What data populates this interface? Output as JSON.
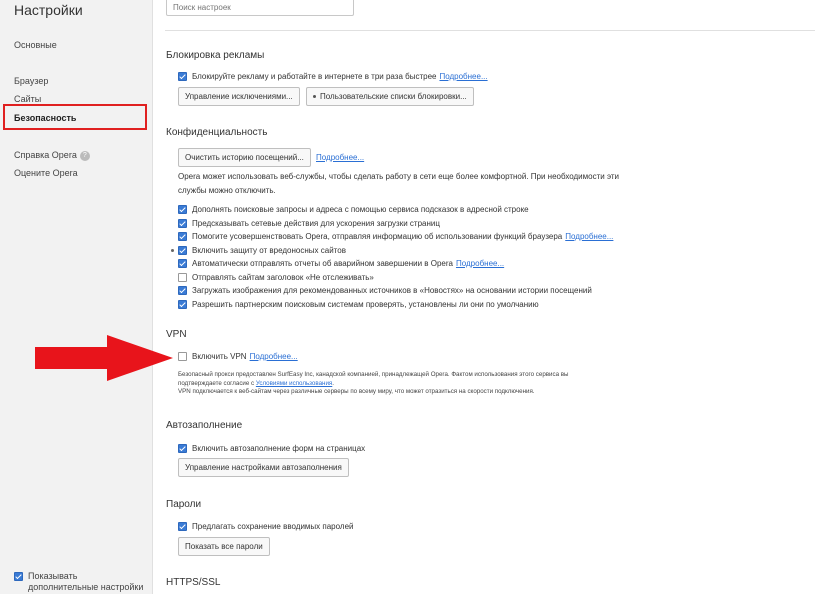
{
  "sidebar": {
    "title": "Настройки",
    "items": [
      {
        "label": "Основные"
      },
      {
        "label": "Браузер"
      },
      {
        "label": "Сайты"
      },
      {
        "label": "Безопасность"
      },
      {
        "label": "Справка Opera"
      },
      {
        "label": "Оцените Opera"
      }
    ],
    "footer_checkbox_label": "Показывать дополнительные настройки"
  },
  "search": {
    "placeholder": "Поиск настроек"
  },
  "ads": {
    "title": "Блокировка рекламы",
    "checkbox_label": "Блокируйте рекламу и работайте в интернете в три раза быстрее",
    "more": "Подробнее...",
    "exceptions_button": "Управление исключениями...",
    "lists_button": "Пользовательские списки блокировки..."
  },
  "privacy": {
    "title": "Конфиденциальность",
    "clear_button": "Очистить историю посещений...",
    "more": "Подробнее...",
    "desc_line1": "Opera может использовать веб-службы, чтобы сделать работу в сети еще более комфортной. При необходимости эти",
    "desc_line2": "службы можно отключить.",
    "options": [
      {
        "label": "Дополнять поисковые запросы и адреса с помощью сервиса подсказок в адресной строке",
        "checked": true
      },
      {
        "label": "Предсказывать сетевые действия для ускорения загрузки страниц",
        "checked": true
      },
      {
        "label": "Помогите усовершенствовать Opera, отправляя информацию об использовании функций браузера",
        "checked": true,
        "link": "Подробнее..."
      },
      {
        "label": "Включить защиту от вредоносных сайтов",
        "checked": true
      },
      {
        "label": "Автоматически отправлять отчеты об аварийном завершении в Opera",
        "checked": true,
        "link": "Подробнее..."
      },
      {
        "label": "Отправлять сайтам заголовок «Не отслеживать»",
        "checked": false
      },
      {
        "label": "Загружать изображения для рекомендованных источников в «Новостях» на основании истории посещений",
        "checked": true
      },
      {
        "label": "Разрешить партнерским поисковым системам проверять, установлены ли они по умолчанию",
        "checked": true
      }
    ]
  },
  "vpn": {
    "title": "VPN",
    "checkbox_label": "Включить VPN",
    "more": "Подробнее...",
    "note_line1": "Безопасный прокси предоставлен SurfEasy Inc, канадской компанией, принадлежащей Opera. Фактом использования этого сервиса вы",
    "note_line2_prefix": "подтверждаете согласие с",
    "note_line2_link": "Условиями использования",
    "note_line3": "VPN подключается к веб-сайтам через различные серверы по всему миру, что может отразиться на скорости подключения."
  },
  "autofill": {
    "title": "Автозаполнение",
    "checkbox_label": "Включить автозаполнение форм на страницах",
    "manage_button": "Управление настройками автозаполнения"
  },
  "passwords": {
    "title": "Пароли",
    "checkbox_label": "Предлагать сохранение вводимых паролей",
    "show_button": "Показать все пароли"
  },
  "https": {
    "title": "HTTPS/SSL"
  },
  "colors": {
    "accent": "#3a7bd5",
    "link": "#2a6fd4",
    "highlight": "#e02020",
    "arrow": "#e8141b"
  }
}
